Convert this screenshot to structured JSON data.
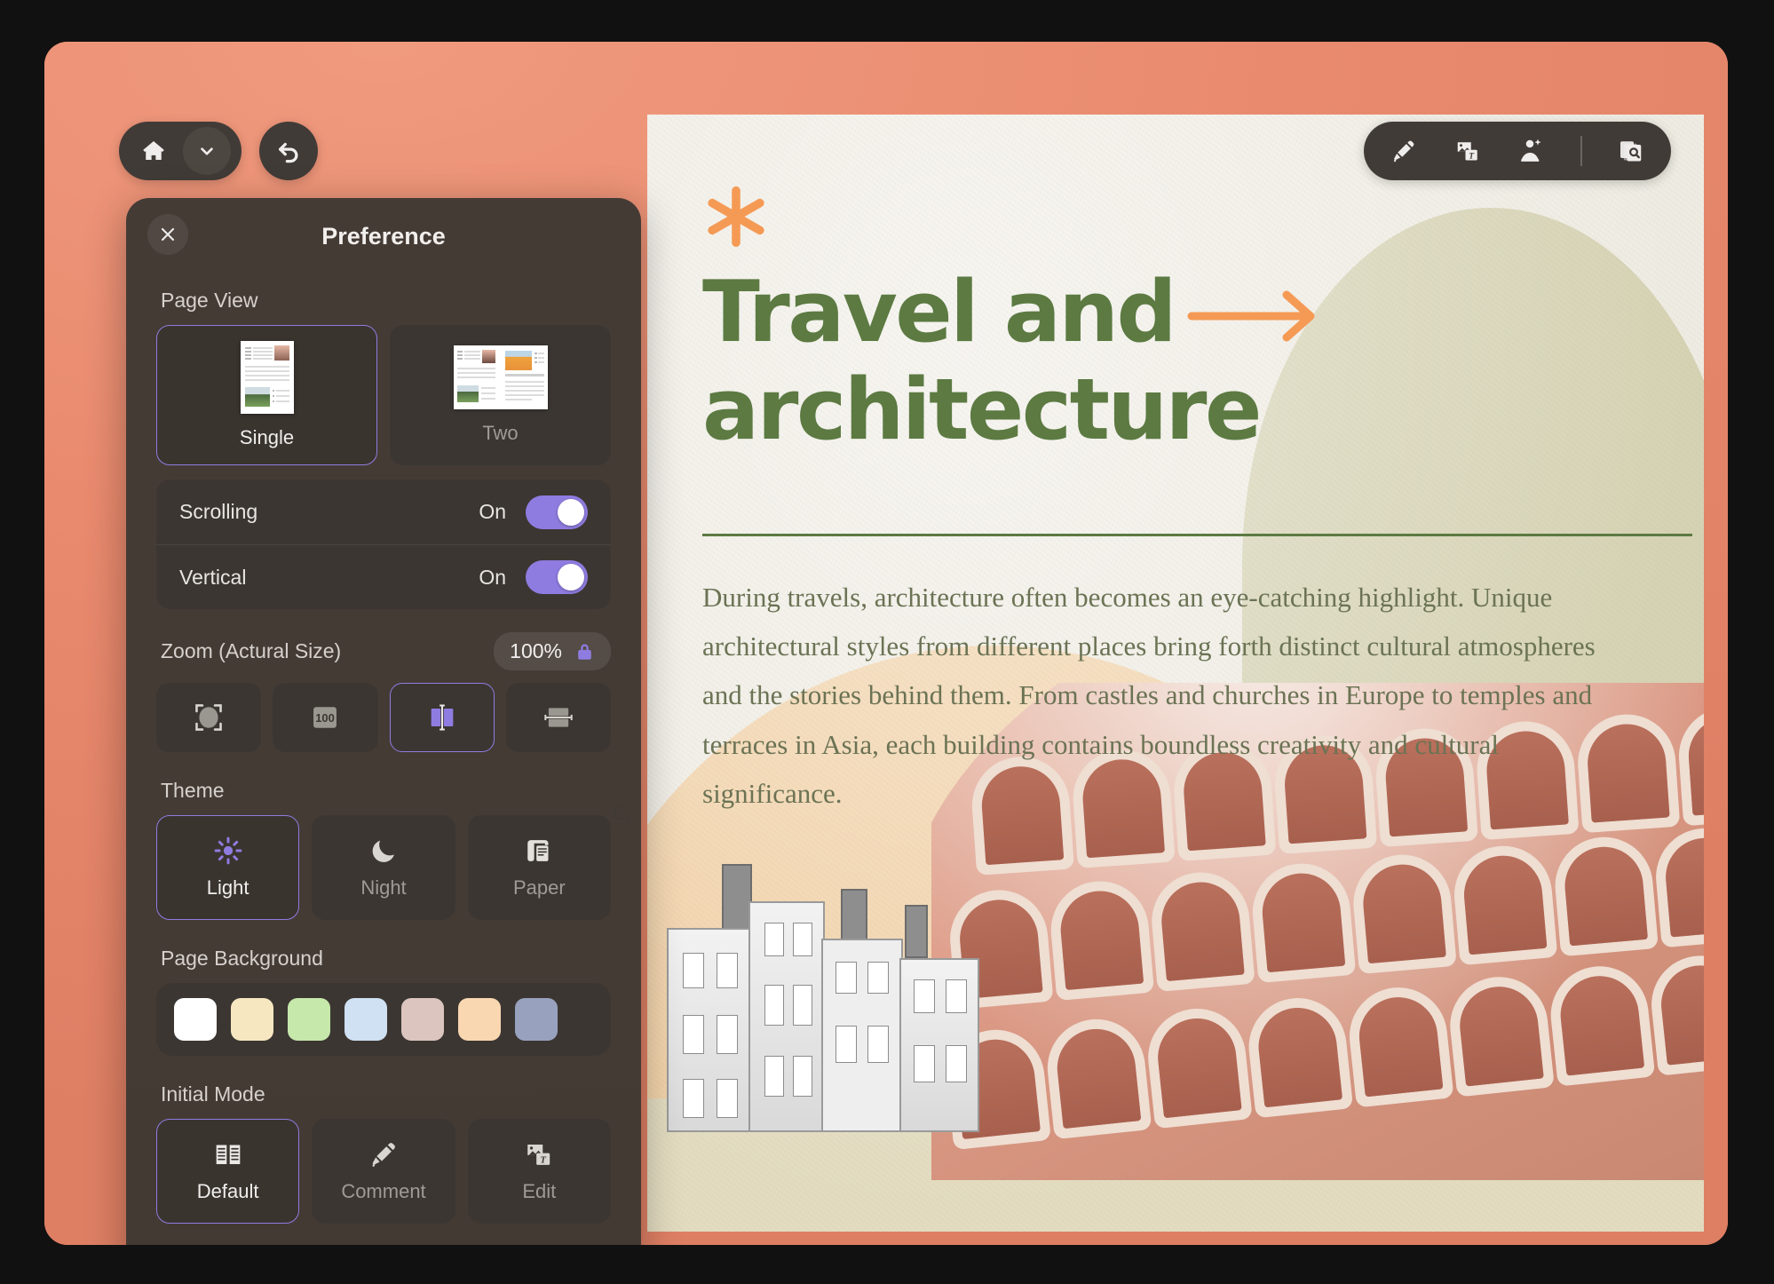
{
  "toolbar_left": {
    "home_icon": "home-icon",
    "dropdown_icon": "chevron-down-icon",
    "undo_icon": "undo-icon"
  },
  "toolbar_right": {
    "items": [
      {
        "icon": "highlighter-icon",
        "name": "highlight-tool"
      },
      {
        "icon": "image-text-icon",
        "name": "edit-tool"
      },
      {
        "icon": "ai-photo-icon",
        "name": "ai-enhance-tool"
      },
      {
        "icon": "page-search-icon",
        "name": "page-search-tool"
      }
    ]
  },
  "panel": {
    "title": "Preference",
    "close_icon": "close-icon",
    "page_view": {
      "label": "Page View",
      "options": [
        {
          "label": "Single",
          "selected": true
        },
        {
          "label": "Two",
          "selected": false
        }
      ]
    },
    "toggles": [
      {
        "label": "Scrolling",
        "state": "On",
        "on": true
      },
      {
        "label": "Vertical",
        "state": "On",
        "on": true
      }
    ],
    "zoom": {
      "label": "Zoom (Actural Size)",
      "value": "100%",
      "lock_icon": "lock-icon",
      "modes": [
        {
          "name": "fit-page-icon",
          "selected": false
        },
        {
          "name": "actual-size-100-icon",
          "selected": false
        },
        {
          "name": "fit-width-icon",
          "selected": true
        },
        {
          "name": "fit-height-icon",
          "selected": false
        }
      ]
    },
    "theme": {
      "label": "Theme",
      "options": [
        {
          "label": "Light",
          "icon": "sun-icon",
          "selected": true
        },
        {
          "label": "Night",
          "icon": "moon-icon",
          "selected": false
        },
        {
          "label": "Paper",
          "icon": "scroll-icon",
          "selected": false
        }
      ]
    },
    "page_background": {
      "label": "Page Background",
      "swatches": [
        "#ffffff",
        "#f7e7c0",
        "#c7e8ab",
        "#cfe1f2",
        "#dcc5bf",
        "#f9d7b1",
        "#98a2be"
      ]
    },
    "initial_mode": {
      "label": "Initial Mode",
      "options": [
        {
          "label": "Default",
          "icon": "open-book-icon",
          "selected": true
        },
        {
          "label": "Comment",
          "icon": "highlighter-icon",
          "selected": false
        },
        {
          "label": "Edit",
          "icon": "image-text-icon",
          "selected": false
        }
      ]
    }
  },
  "document": {
    "asterisk_icon": "asterisk-icon",
    "title": "Travel and architecture",
    "arrow_icon": "arrow-right-icon",
    "body": "During travels, architecture often becomes an eye-catching highlight. Unique architectural styles from different places bring forth distinct cultural atmospheres and the stories behind them. From castles and churches in Europe to temples and terraces in Asia, each building contains boundless creativity and cultural significance.",
    "peek_text": "e.",
    "colors": {
      "heading": "#5c7a42",
      "accent": "#f59a55",
      "body_text": "#6b7354",
      "page_bg": "#efece3",
      "arch": "#d6d3b4",
      "blob": "#f2d2a8",
      "band": "#e3dcc0",
      "app_bg": "#e98a6e",
      "panel_bg": "#3e3833",
      "selection": "#8f7ce0"
    }
  }
}
